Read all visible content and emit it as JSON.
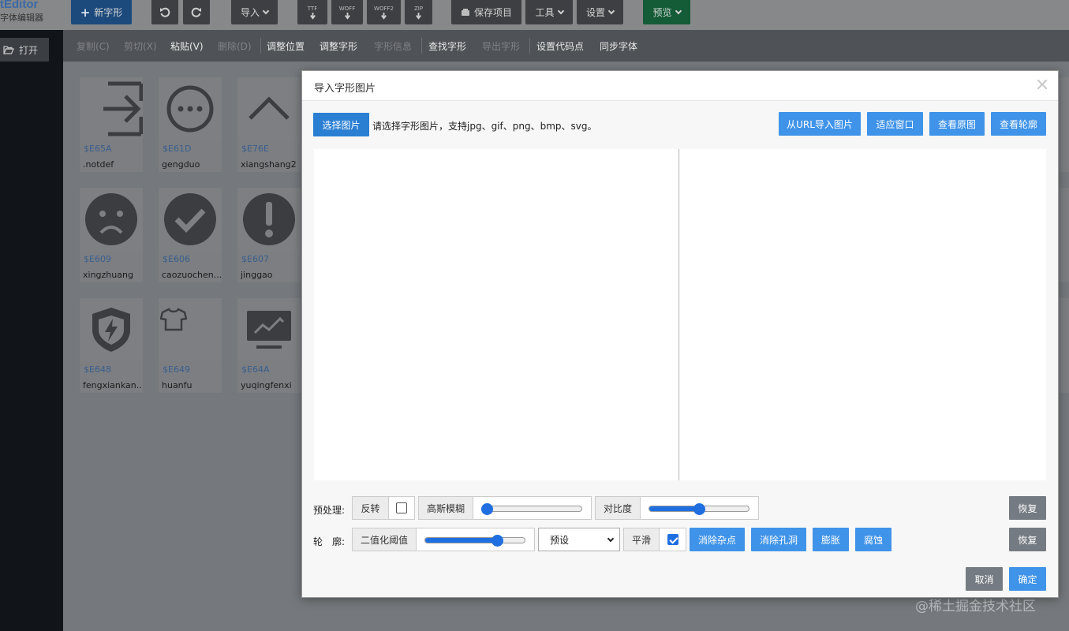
{
  "app": {
    "title": "tEditor",
    "subtitle": "字体编辑器"
  },
  "toolbar": {
    "new_glyph": "新字形",
    "import": "导入",
    "ttf": "TTF",
    "woff": "WOFF",
    "woff2": "WOFF2",
    "zip": "ZIP",
    "save_project": "保存项目",
    "tools": "工具",
    "settings": "设置",
    "preview": "预览"
  },
  "sidebar": {
    "open": "打开"
  },
  "editbar": [
    {
      "label": "复制(C)",
      "enabled": false
    },
    {
      "label": "剪切(X)",
      "enabled": false
    },
    {
      "label": "粘贴(V)",
      "enabled": true
    },
    {
      "label": "删除(D)",
      "enabled": false
    },
    {
      "label": "调整位置",
      "enabled": true
    },
    {
      "label": "调整字形",
      "enabled": true
    },
    {
      "label": "字形信息",
      "enabled": false
    },
    {
      "label": "查找字形",
      "enabled": true
    },
    {
      "label": "导出字形",
      "enabled": false
    },
    {
      "label": "设置代码点",
      "enabled": true
    },
    {
      "label": "同步字体",
      "enabled": true
    }
  ],
  "glyphs": [
    {
      "code": "$E65A",
      "name": ".notdef",
      "icon": "exit-icon"
    },
    {
      "code": "$E61D",
      "name": "gengduo",
      "icon": "more-icon"
    },
    {
      "code": "$E76E",
      "name": "xiangshang2",
      "icon": "chevron-up-icon"
    },
    {
      "code": "$E609",
      "name": "xingzhuang",
      "icon": "sad-face-icon"
    },
    {
      "code": "$E606",
      "name": "caozuochen...",
      "icon": "check-circle-icon"
    },
    {
      "code": "$E607",
      "name": "jinggao",
      "icon": "warning-icon"
    },
    {
      "code": "$E648",
      "name": "fengxiankan...",
      "icon": "shield-bolt-icon"
    },
    {
      "code": "$E649",
      "name": "huanfu",
      "icon": "shirt-icon"
    },
    {
      "code": "$E64A",
      "name": "yuqingfenxi",
      "icon": "monitor-chart-icon"
    }
  ],
  "modal": {
    "title": "导入字形图片",
    "choose_image": "选择图片",
    "hint": "请选择字形图片，支持jpg、gif、png、bmp、svg。",
    "import_url": "从URL导入图片",
    "fit_window": "适应窗口",
    "view_original": "查看原图",
    "view_outline": "查看轮廓",
    "preprocess": {
      "label": "预处理:",
      "invert": "反转",
      "invert_checked": false,
      "gaussian_blur": "高斯模糊",
      "gaussian_blur_value": 0.0,
      "contrast": "对比度",
      "contrast_value": 0.5,
      "reset": "恢复"
    },
    "contour": {
      "label": "轮　廓:",
      "threshold": "二值化阈值",
      "threshold_value": 0.75,
      "preset": "预设",
      "smooth": "平滑",
      "smooth_checked": true,
      "remove_noise": "消除杂点",
      "remove_holes": "消除孔洞",
      "dilate": "膨胀",
      "erode": "腐蚀",
      "reset": "恢复"
    },
    "cancel": "取消",
    "ok": "确定"
  },
  "watermark": "@稀土掘金技术社区"
}
